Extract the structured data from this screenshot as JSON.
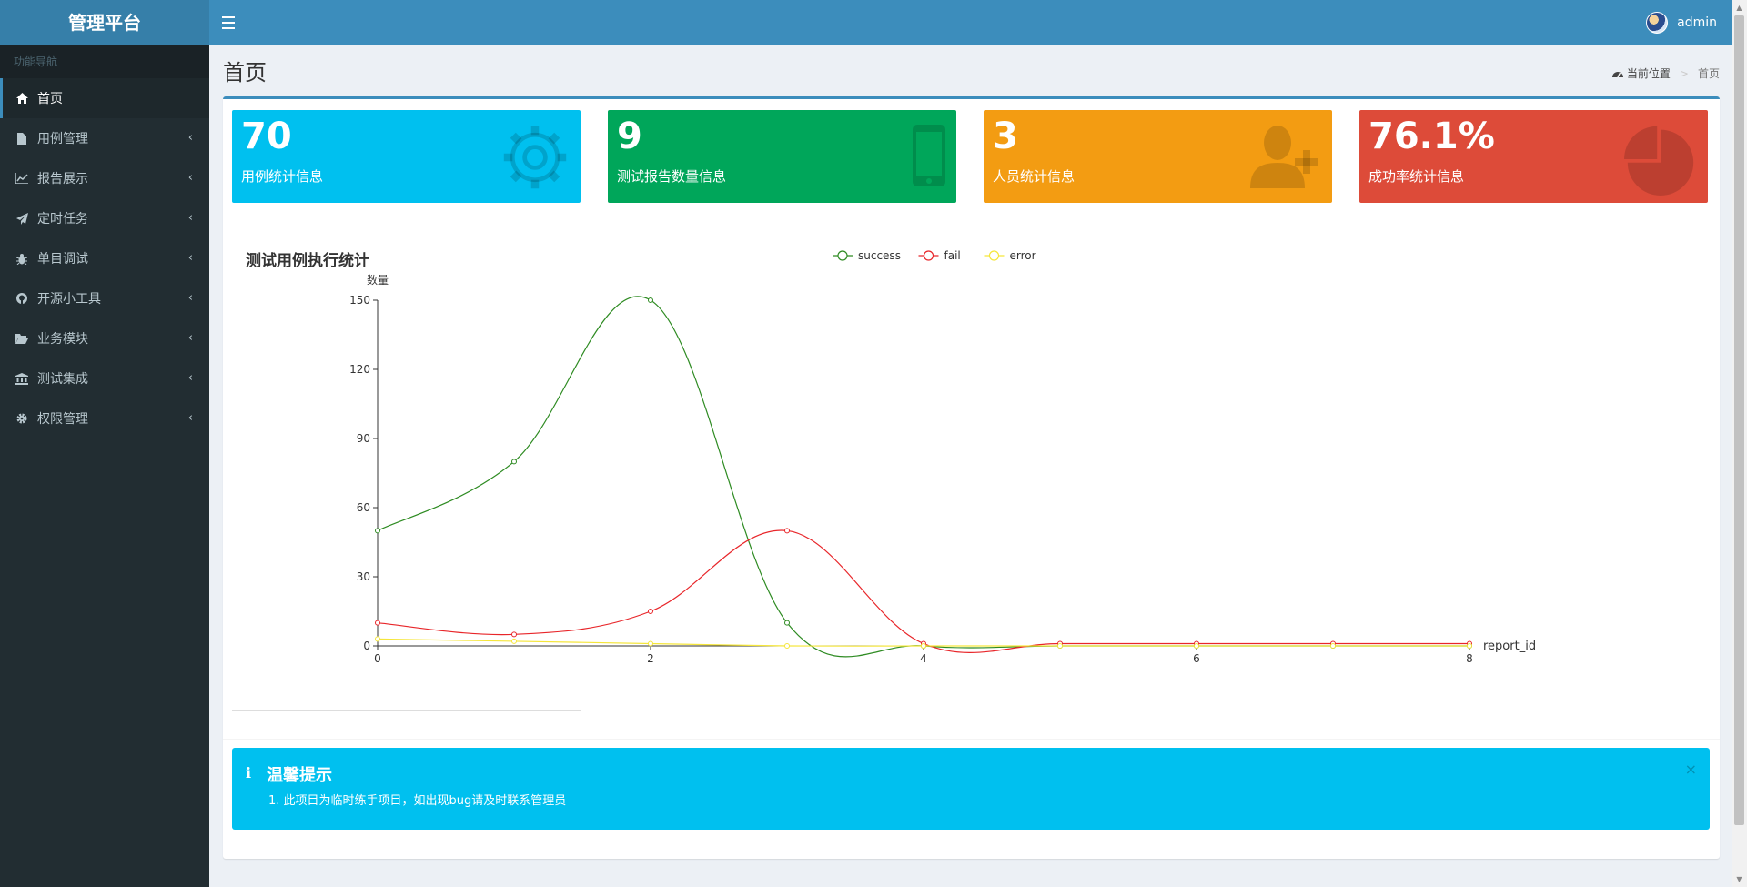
{
  "app": {
    "title": "管理平台",
    "user": "admin"
  },
  "sidebar": {
    "header": "功能导航",
    "items": [
      {
        "label": "首页",
        "icon": "home-icon",
        "active": true
      },
      {
        "label": "用例管理",
        "icon": "file-icon"
      },
      {
        "label": "报告展示",
        "icon": "line-chart-icon"
      },
      {
        "label": "定时任务",
        "icon": "paper-plane-icon"
      },
      {
        "label": "单目调试",
        "icon": "bug-icon"
      },
      {
        "label": "开源小工具",
        "icon": "github-icon"
      },
      {
        "label": "业务模块",
        "icon": "folder-open-icon"
      },
      {
        "label": "测试集成",
        "icon": "bank-icon"
      },
      {
        "label": "权限管理",
        "icon": "gear-icon"
      }
    ]
  },
  "page": {
    "title": "首页"
  },
  "breadcrumb": {
    "location": "当前位置",
    "current": "首页"
  },
  "stats": [
    {
      "value": "70",
      "label": "用例统计信息",
      "color": "#00c0ef",
      "icon": "gear-icon"
    },
    {
      "value": "9",
      "label": "测试报告数量信息",
      "color": "#00a65a",
      "icon": "mobile-icon"
    },
    {
      "value": "3",
      "label": "人员统计信息",
      "color": "#f39c12",
      "icon": "user-plus-icon"
    },
    {
      "value": "76.1%",
      "label": "成功率统计信息",
      "color": "#dd4b39",
      "icon": "pie-chart-icon"
    }
  ],
  "chart_data": {
    "type": "line",
    "title": "测试用例执行统计",
    "xlabel": "report_id",
    "ylabel": "数量",
    "x": [
      0,
      1,
      2,
      3,
      4,
      5,
      6,
      7,
      8
    ],
    "xlim": [
      0,
      8
    ],
    "xticks": [
      0,
      2,
      4,
      6,
      8
    ],
    "ylim": [
      0,
      150
    ],
    "yticks": [
      0,
      30,
      60,
      90,
      120,
      150
    ],
    "legend": "top",
    "series": [
      {
        "name": "success",
        "color": "#2e8b22",
        "values": [
          50,
          80,
          150,
          10,
          0,
          0,
          0,
          0,
          0
        ]
      },
      {
        "name": "fail",
        "color": "#e8262a",
        "values": [
          10,
          5,
          15,
          50,
          1,
          1,
          1,
          1,
          1
        ]
      },
      {
        "name": "error",
        "color": "#f5e63b",
        "values": [
          3,
          2,
          1,
          0,
          0,
          0,
          0,
          0,
          0
        ]
      }
    ]
  },
  "alert": {
    "title": "温馨提示",
    "text": "1. 此项目为临时练手项目，如出现bug请及时联系管理员",
    "close": "×"
  }
}
